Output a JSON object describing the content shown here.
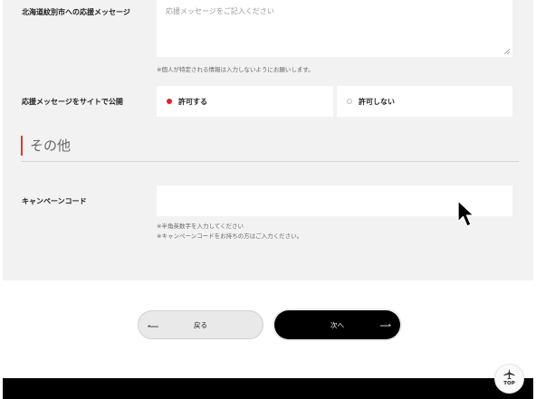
{
  "form": {
    "message_label": "北海道紋別市への応援メッセージ",
    "message_placeholder": "応援メッセージをご記入ください",
    "message_note": "※個人が特定される情報は入力しないようにお願いします。",
    "publish_label": "応援メッセージをサイトで公開",
    "publish_options": [
      {
        "label": "許可する",
        "selected": true
      },
      {
        "label": "許可しない",
        "selected": false
      }
    ]
  },
  "other_section": {
    "title": "その他",
    "campaign_label": "キャンペーンコード",
    "campaign_value": "",
    "notes": [
      "※半角英数字を入力してください",
      "※キャンペーンコードをお持ちの方はご入力ください。"
    ]
  },
  "nav": {
    "back_label": "戻る",
    "next_label": "次へ"
  },
  "page_top": {
    "label": "TOP"
  },
  "colors": {
    "accent": "#e0202a",
    "panel_bg": "#f2f2f2",
    "primary_button": "#000000"
  }
}
